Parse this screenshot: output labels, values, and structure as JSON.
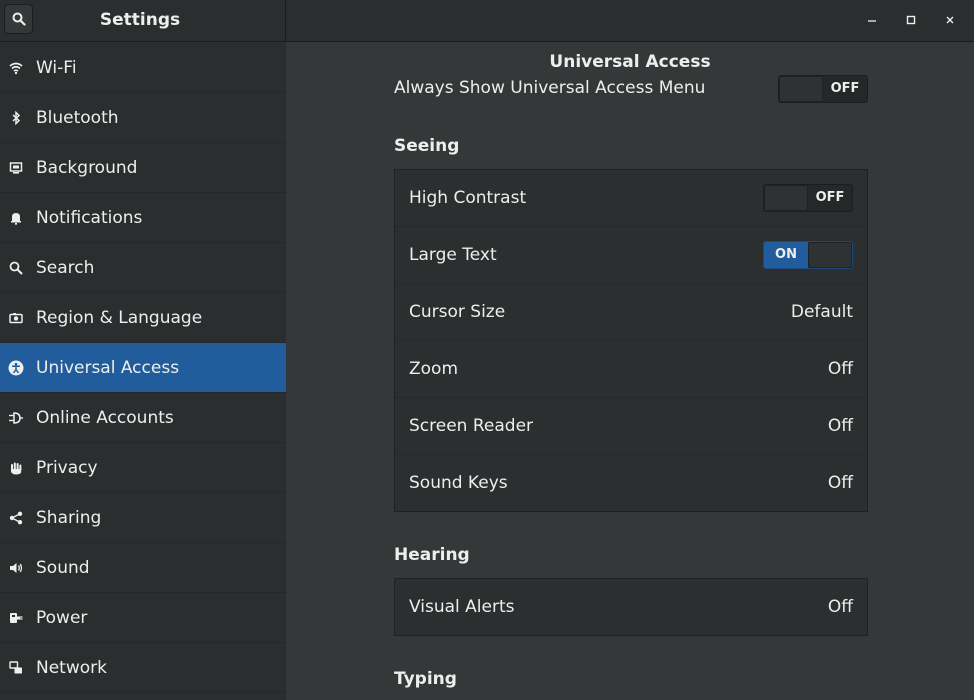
{
  "header": {
    "sidebar_title": "Settings",
    "panel_title": "Universal Access"
  },
  "sidebar": {
    "items": [
      {
        "label": "Wi-Fi",
        "icon": "wifi-icon"
      },
      {
        "label": "Bluetooth",
        "icon": "bluetooth-icon"
      },
      {
        "label": "Background",
        "icon": "background-icon"
      },
      {
        "label": "Notifications",
        "icon": "bell-icon"
      },
      {
        "label": "Search",
        "icon": "search-icon"
      },
      {
        "label": "Region & Language",
        "icon": "camera-icon"
      },
      {
        "label": "Universal Access",
        "icon": "accessibility-icon",
        "active": true
      },
      {
        "label": "Online Accounts",
        "icon": "online-accounts-icon"
      },
      {
        "label": "Privacy",
        "icon": "hand-icon"
      },
      {
        "label": "Sharing",
        "icon": "share-icon"
      },
      {
        "label": "Sound",
        "icon": "speaker-icon"
      },
      {
        "label": "Power",
        "icon": "power-plug-icon"
      },
      {
        "label": "Network",
        "icon": "network-icon"
      }
    ]
  },
  "main": {
    "always_show": {
      "label": "Always Show Universal Access Menu",
      "state": "OFF"
    },
    "seeing": {
      "title": "Seeing",
      "rows": [
        {
          "label": "High Contrast",
          "switch": "OFF"
        },
        {
          "label": "Large Text",
          "switch": "ON"
        },
        {
          "label": "Cursor Size",
          "value": "Default"
        },
        {
          "label": "Zoom",
          "value": "Off"
        },
        {
          "label": "Screen Reader",
          "value": "Off"
        },
        {
          "label": "Sound Keys",
          "value": "Off"
        }
      ]
    },
    "hearing": {
      "title": "Hearing",
      "rows": [
        {
          "label": "Visual Alerts",
          "value": "Off"
        }
      ]
    },
    "typing": {
      "title": "Typing"
    }
  },
  "colors": {
    "accent": "#215d9c",
    "sidebar_bg": "#2b2e2f",
    "main_bg": "#353839"
  }
}
